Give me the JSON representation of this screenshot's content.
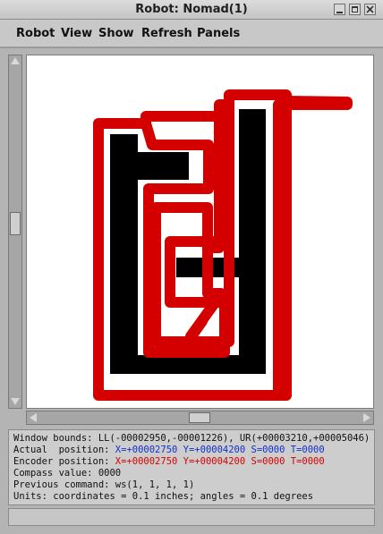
{
  "window": {
    "title": "Robot: Nomad(1)"
  },
  "menu": {
    "items": [
      "Robot",
      "View",
      "Show",
      "Refresh",
      "Panels"
    ]
  },
  "info": {
    "window_bounds": "Window bounds: LL(-00002950,-00001226), UR(+00003210,+00005046)",
    "actual_label": "Actual  position: ",
    "actual_value": "X=+00002750 Y=+00004200 S=0000 T=0000",
    "encoder_label": "Encoder position: ",
    "encoder_value": "X=+00002750 Y=+00004200 S=0000 T=0000",
    "compass": "Compass value: 0000",
    "previous_command": "Previous command: ws(1, 1, 1, 1)",
    "units": "Units: coordinates = 0.1 inches; angles = 0.1 degrees"
  },
  "colors": {
    "robot_path": "#d40000",
    "obstacle": "#000000",
    "actual_position_text": "#1530c8",
    "encoder_position_text": "#d60000"
  },
  "icons": {
    "window_minimize": "minimize-icon",
    "window_maximize": "maximize-icon",
    "window_close": "close-icon"
  }
}
